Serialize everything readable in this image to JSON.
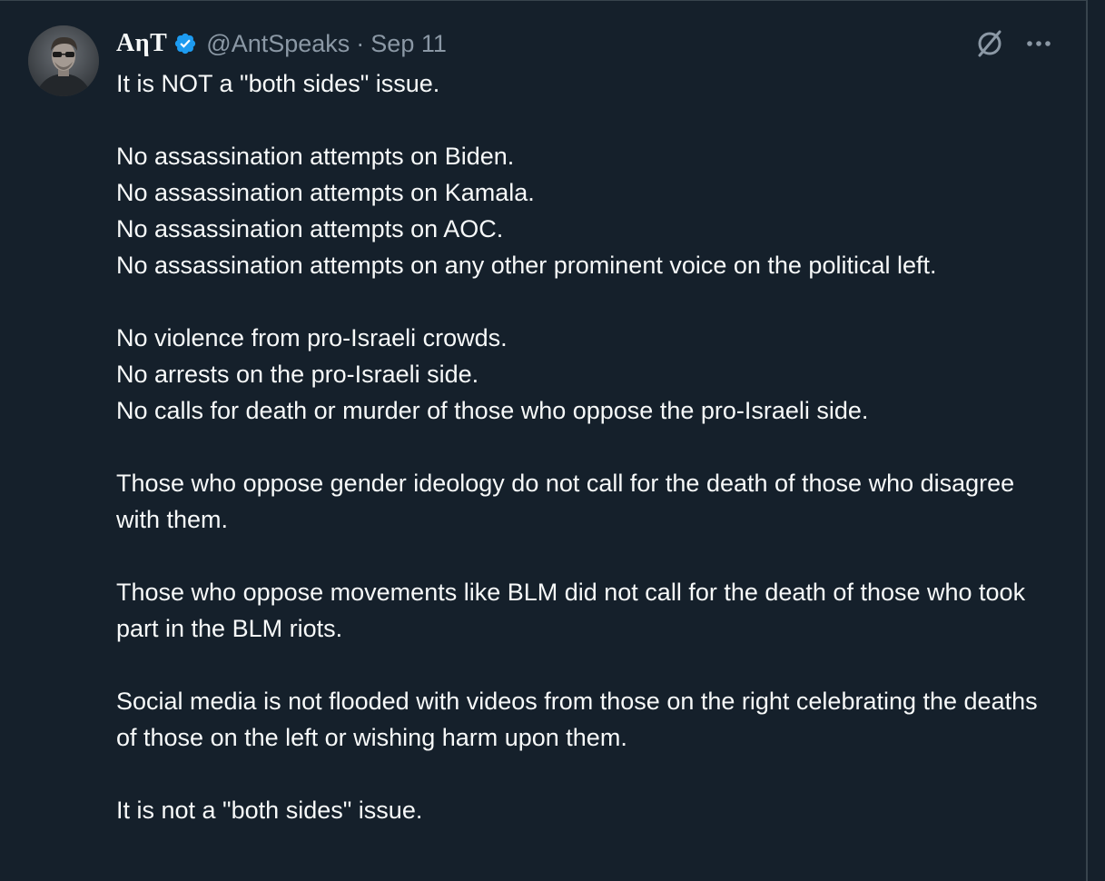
{
  "tweet": {
    "author": {
      "display_name": "AηT",
      "handle": "@AntSpeaks",
      "verified": true,
      "verified_color": "#1d9bf0"
    },
    "separator": "·",
    "date": "Sep 11",
    "actions": {
      "grok_icon": "grok-icon",
      "more_icon": "more-icon"
    },
    "paragraphs": [
      "It is NOT a \"both sides\" issue.",
      "No assassination attempts on Biden.\nNo assassination attempts on Kamala.\nNo assassination attempts on AOC.\nNo assassination attempts on any other prominent voice on the political left.",
      "No violence from pro-Israeli crowds.\nNo arrests on the pro-Israeli side.\nNo calls for death or murder of those who oppose the pro-Israeli side.",
      "Those who oppose gender ideology do not call for the death of those who disagree with them.",
      "Those who oppose movements like BLM did not call for the death of those who took part in the BLM riots.",
      "Social media is not flooded with videos from those on the right celebrating the deaths of those on the left or wishing harm upon them.",
      "It is not a \"both sides\" issue."
    ]
  },
  "theme": {
    "background": "#15202b",
    "text": "#f7f9f9",
    "secondary_text": "#8b98a5",
    "border": "#38444d"
  }
}
